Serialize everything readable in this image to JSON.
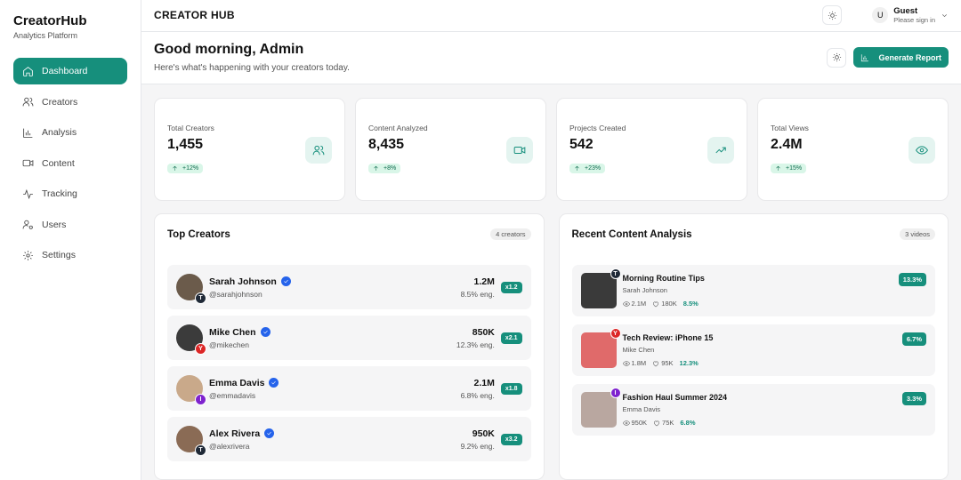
{
  "brand": {
    "name": "CreatorHub",
    "subtitle": "Analytics Platform"
  },
  "nav": [
    {
      "label": "Dashboard",
      "icon": "home-icon",
      "active": true
    },
    {
      "label": "Creators",
      "icon": "users-icon"
    },
    {
      "label": "Analysis",
      "icon": "bar-chart-icon"
    },
    {
      "label": "Content",
      "icon": "video-icon"
    },
    {
      "label": "Tracking",
      "icon": "activity-icon"
    },
    {
      "label": "Users",
      "icon": "user-cog-icon"
    },
    {
      "label": "Settings",
      "icon": "gear-icon"
    }
  ],
  "topbar": {
    "title": "CREATOR HUB",
    "user": {
      "initial": "U",
      "name": "Guest",
      "sub": "Please sign in"
    }
  },
  "header": {
    "greeting": "Good morning, Admin",
    "subtitle": "Here's what's happening with your creators today.",
    "report_label": "Generate Report"
  },
  "stats": [
    {
      "label": "Total Creators",
      "value": "1,455",
      "change": "+12%",
      "icon": "users-icon"
    },
    {
      "label": "Content Analyzed",
      "value": "8,435",
      "change": "+8%",
      "icon": "video-icon"
    },
    {
      "label": "Projects Created",
      "value": "542",
      "change": "+23%",
      "icon": "trending-up-icon"
    },
    {
      "label": "Total Views",
      "value": "2.4M",
      "change": "+15%",
      "icon": "eye-icon"
    }
  ],
  "top_creators": {
    "title": "Top Creators",
    "count": "4 creators",
    "items": [
      {
        "name": "Sarah Johnson",
        "handle": "@sarahjohnson",
        "value": "1.2M",
        "eng": "8.5% eng.",
        "mult": "x1.2",
        "platform": "T",
        "platform_color": "#1f2937",
        "avatar_color": "#6b5b4b"
      },
      {
        "name": "Mike Chen",
        "handle": "@mikechen",
        "value": "850K",
        "eng": "12.3% eng.",
        "mult": "x2.1",
        "platform": "Y",
        "platform_color": "#dc2626",
        "avatar_color": "#3b3b3b"
      },
      {
        "name": "Emma Davis",
        "handle": "@emmadavis",
        "value": "2.1M",
        "eng": "6.8% eng.",
        "mult": "x1.8",
        "platform": "I",
        "platform_color": "#7e22ce",
        "avatar_color": "#c9a98a"
      },
      {
        "name": "Alex Rivera",
        "handle": "@alexrivera",
        "value": "950K",
        "eng": "9.2% eng.",
        "mult": "x3.2",
        "platform": "T",
        "platform_color": "#1f2937",
        "avatar_color": "#8a6b55"
      }
    ]
  },
  "recent_content": {
    "title": "Recent Content Analysis",
    "count": "3 videos",
    "items": [
      {
        "title": "Morning Routine Tips",
        "author": "Sarah Johnson",
        "views": "2.1M",
        "likes": "180K",
        "eng": "8.5%",
        "pct": "13.3%",
        "platform": "T",
        "platform_color": "#1f2937",
        "thumb_color": "#3a3a3a"
      },
      {
        "title": "Tech Review: iPhone 15",
        "author": "Mike Chen",
        "views": "1.8M",
        "likes": "95K",
        "eng": "12.3%",
        "pct": "6.7%",
        "platform": "Y",
        "platform_color": "#dc2626",
        "thumb_color": "#e06a6a"
      },
      {
        "title": "Fashion Haul Summer 2024",
        "author": "Emma Davis",
        "views": "950K",
        "likes": "75K",
        "eng": "6.8%",
        "pct": "3.3%",
        "platform": "I",
        "platform_color": "#7e22ce",
        "thumb_color": "#b9a7a0"
      }
    ]
  }
}
